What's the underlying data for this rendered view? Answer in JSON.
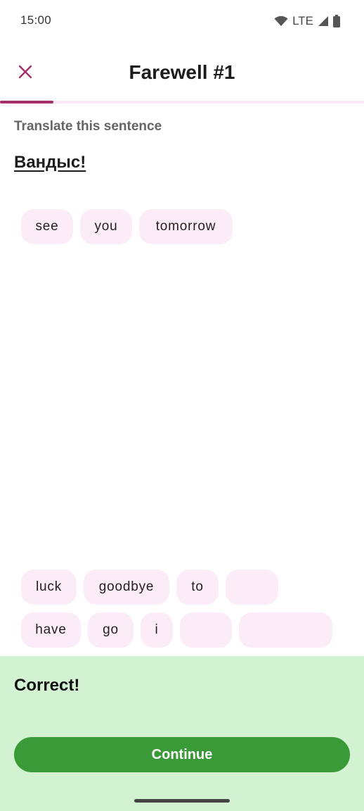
{
  "status_bar": {
    "time": "15:00",
    "network": "LTE",
    "icons": [
      "wifi-icon",
      "signal-icon",
      "battery-icon"
    ]
  },
  "header": {
    "title": "Farewell #1",
    "close_icon": "close-icon",
    "progress_fraction": 0.147
  },
  "lesson": {
    "instruction": "Translate this sentence",
    "sentence": "Вандыс!"
  },
  "answer_chips": [
    "see",
    "you",
    "tomorrow"
  ],
  "word_bank": {
    "visible": [
      "luck",
      "goodbye",
      "to",
      "have",
      "go",
      "i"
    ],
    "used_slots": 3
  },
  "feedback": {
    "message": "Correct!",
    "continue_label": "Continue"
  },
  "colors": {
    "accent": "#a3306a",
    "chip_bg": "#fcecf7",
    "success_bg": "#d2f2d2",
    "success_button": "#3a9a38"
  }
}
